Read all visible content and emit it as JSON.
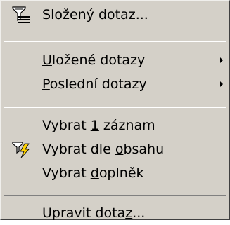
{
  "menu": {
    "items": [
      {
        "pre": "",
        "mn": "S",
        "post": "ložený dotaz...",
        "icon": "filter-query-icon",
        "submenu": false
      },
      {
        "pre": "",
        "mn": "U",
        "post": "ložené dotazy",
        "icon": "",
        "submenu": true
      },
      {
        "pre": "",
        "mn": "P",
        "post": "oslední dotazy",
        "icon": "",
        "submenu": true
      },
      {
        "pre": "Vybrat ",
        "mn": "1",
        "post": " záznam",
        "icon": "",
        "submenu": false
      },
      {
        "pre": "Vybrat dle ",
        "mn": "o",
        "post": "bsahu",
        "icon": "filter-by-selection-icon",
        "submenu": false
      },
      {
        "pre": "Vybrat ",
        "mn": "d",
        "post": "oplněk",
        "icon": "",
        "submenu": false
      },
      {
        "pre": "Upravit dota",
        "mn": "z",
        "post": "...",
        "icon": "",
        "submenu": false
      }
    ]
  }
}
